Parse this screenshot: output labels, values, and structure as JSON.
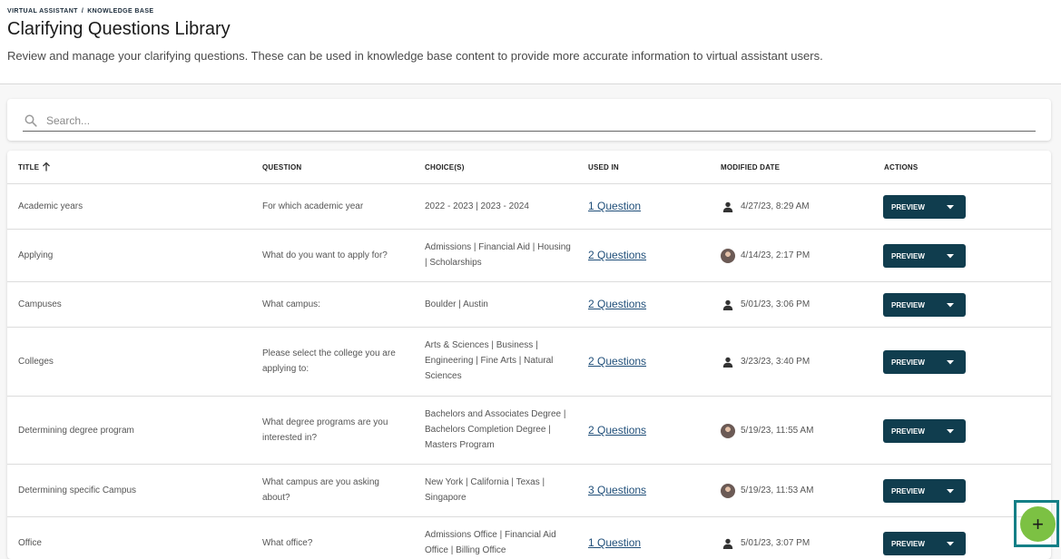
{
  "breadcrumb": {
    "items": [
      "VIRTUAL ASSISTANT",
      "KNOWLEDGE BASE"
    ],
    "separator": "/"
  },
  "page": {
    "title": "Clarifying Questions Library",
    "subtitle": "Review and manage your clarifying questions. These can be used in knowledge base content to provide more accurate information to virtual assistant users."
  },
  "search": {
    "placeholder": "Search...",
    "value": "",
    "icon": "search-icon"
  },
  "table": {
    "headers": {
      "title": "TITLE",
      "question": "QUESTION",
      "choices": "CHOICE(S)",
      "used_in": "USED IN",
      "modified_date": "MODIFIED DATE",
      "actions": "ACTIONS"
    },
    "sort": {
      "column": "title",
      "direction": "ascending",
      "icon": "arrow-up-icon"
    },
    "rows": [
      {
        "title": "Academic years",
        "question": "For which academic year",
        "choices": "2022 - 2023 | 2023 - 2024",
        "used_in": "1 Question",
        "modified_by_icon": "person-icon",
        "modified_date": "4/27/23, 8:29 AM",
        "action_label": "PREVIEW"
      },
      {
        "title": "Applying",
        "question": "What do you want to apply for?",
        "choices": "Admissions | Financial Aid | Housing | Scholarships",
        "used_in": "2 Questions",
        "modified_by_icon": "user-avatar",
        "modified_date": "4/14/23, 2:17 PM",
        "action_label": "PREVIEW"
      },
      {
        "title": "Campuses",
        "question": "What campus:",
        "choices": "Boulder | Austin",
        "used_in": "2 Questions",
        "modified_by_icon": "person-icon",
        "modified_date": "5/01/23, 3:06 PM",
        "action_label": "PREVIEW"
      },
      {
        "title": "Colleges",
        "question": "Please select the college you are applying to:",
        "choices": "Arts & Sciences | Business | Engineering | Fine Arts | Natural Sciences",
        "used_in": "2 Questions",
        "modified_by_icon": "person-icon",
        "modified_date": "3/23/23, 3:40 PM",
        "action_label": "PREVIEW"
      },
      {
        "title": "Determining degree program",
        "question": "What degree programs are you interested in?",
        "choices": "Bachelors and Associates Degree | Bachelors Completion Degree | Masters Program",
        "used_in": "2 Questions",
        "modified_by_icon": "user-avatar",
        "modified_date": "5/19/23, 11:55 AM",
        "action_label": "PREVIEW"
      },
      {
        "title": "Determining specific Campus",
        "question": "What campus are you asking about?",
        "choices": "New York | California | Texas | Singapore",
        "used_in": "3 Questions",
        "modified_by_icon": "user-avatar",
        "modified_date": "5/19/23, 11:53 AM",
        "action_label": "PREVIEW"
      },
      {
        "title": "Office",
        "question": "What office?",
        "choices": "Admissions Office | Financial Aid Office | Billing Office",
        "used_in": "1 Question",
        "modified_by_icon": "person-icon",
        "modified_date": "5/01/23, 3:07 PM",
        "action_label": "PREVIEW"
      }
    ]
  },
  "fab": {
    "label": "+",
    "icon": "plus-icon",
    "color": "#7cc143"
  },
  "colors": {
    "primary_button": "#103d4e",
    "link": "#1f4e79",
    "fab_focus_ring": "#147f86"
  }
}
